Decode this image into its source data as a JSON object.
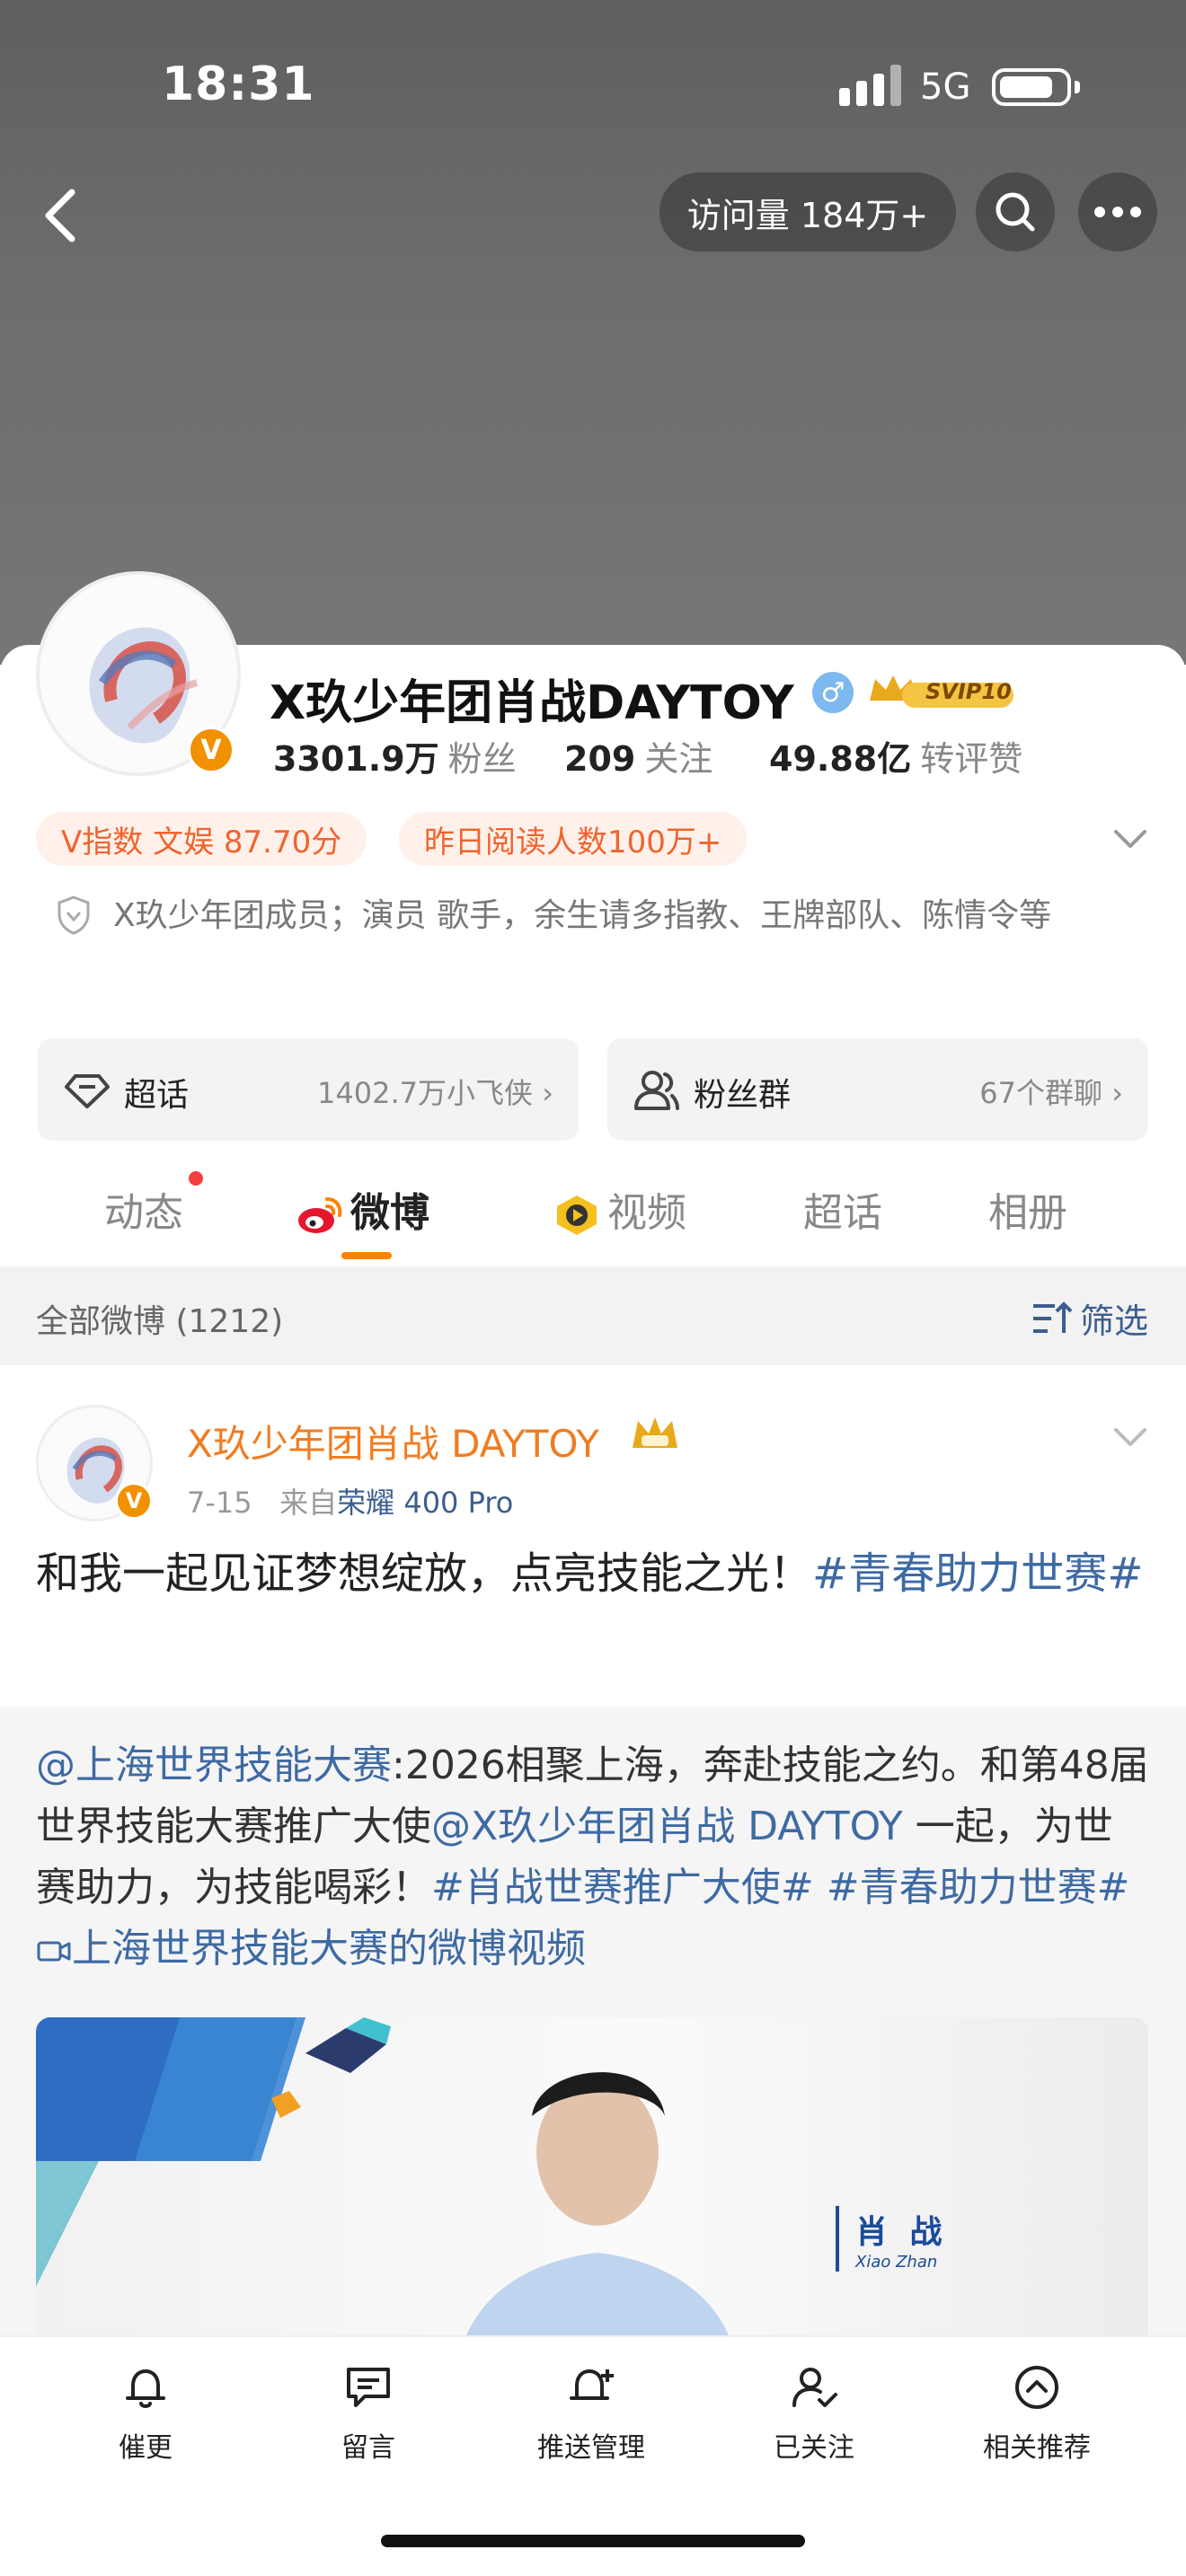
{
  "status_bar": {
    "time": "18:31",
    "network": "5G"
  },
  "header": {
    "visits": "访问量 184万+"
  },
  "profile": {
    "name": "X玖少年团肖战DAYTOY",
    "gender_symbol": "♂",
    "vip_badge": "SVIP10",
    "verify_mark": "V",
    "stats": [
      {
        "value": "3301.9万",
        "label": "粉丝"
      },
      {
        "value": "209",
        "label": "关注"
      },
      {
        "value": "49.88亿",
        "label": "转评赞"
      }
    ],
    "tags": [
      "V指数 文娱 87.70分",
      "昨日阅读人数100万+"
    ],
    "bio": "X玖少年团成员；演员 歌手，余生请多指教、王牌部队、陈情令等",
    "supertopic": {
      "label": "超话",
      "detail": "1402.7万小飞侠"
    },
    "fangroup": {
      "label": "粉丝群",
      "detail": "67个群聊"
    }
  },
  "tabs": [
    "动态",
    "微博",
    "视频",
    "超话",
    "相册"
  ],
  "active_tab": "微博",
  "filter": {
    "left": "全部微博 (1212)",
    "right": "筛选"
  },
  "post": {
    "author": "X玖少年团肖战 DAYTOY",
    "date": "7-15",
    "source_prefix": "来自",
    "device": "荣耀 400 Pro",
    "text_plain": "和我一起见证梦想绽放，点亮技能之光！",
    "text_tag": "#青春助力世赛#",
    "repost": {
      "mention": "@上海世界技能大赛",
      "text1": ":2026相聚上海，奔赴技能之约。和第48届世界技能大赛推广大使",
      "mention2": "@X玖少年团肖战 DAYTOY",
      "text2": " 一起，为世赛助力，为技能喝彩！",
      "tag1": "#肖战世赛推广大使#",
      "tag2": "#青春助力世赛#",
      "video_link": "上海世界技能大赛的微博视频"
    },
    "media_caption": {
      "name": "肖 战",
      "pinyin": "Xiao Zhan"
    }
  },
  "bottom_bar": [
    "催更",
    "留言",
    "推送管理",
    "已关注",
    "相关推荐"
  ],
  "colors": {
    "accent": "#ff8200",
    "link": "#3e6aa3",
    "tag_text": "#f0642e",
    "tag_bg": "#fff1ea"
  }
}
